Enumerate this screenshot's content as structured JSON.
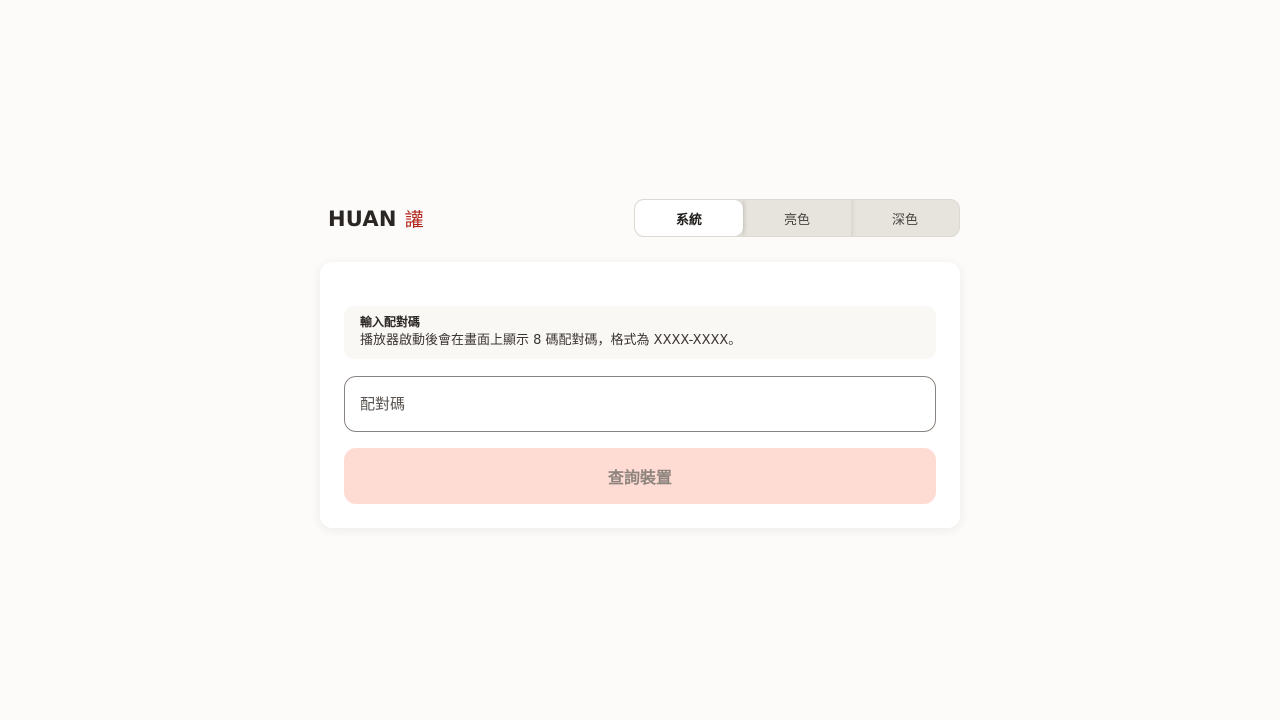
{
  "brand": {
    "name": "HUAN",
    "mark": "讙"
  },
  "theme_switch": {
    "options": [
      "系統",
      "亮色",
      "深色"
    ],
    "selected": "系統"
  },
  "pairing": {
    "title": "輸入配對碼",
    "description": "播放器啟動後會在畫面上顯示 8 碼配對碼，格式為 XXXX-XXXX。",
    "input_placeholder": "配對碼",
    "input_value": "",
    "submit_label": "查詢裝置",
    "submit_disabled": true
  },
  "colors": {
    "background": "#fcfbf9",
    "accent": "#b3261e",
    "button_disabled_bg": "#ffdcd3"
  }
}
